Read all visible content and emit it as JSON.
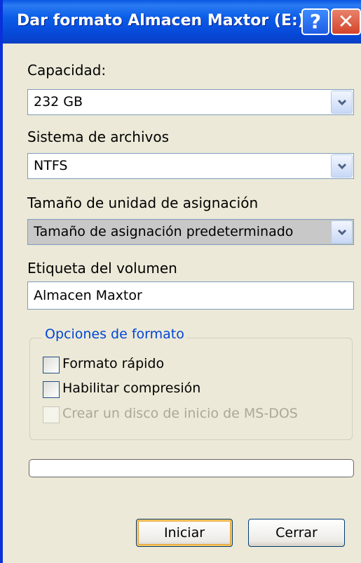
{
  "window": {
    "title": "Dar formato Almacen Maxtor (E:)",
    "help_glyph": "?",
    "close_glyph": "✕"
  },
  "capacity": {
    "label": "Capacidad:",
    "value": "232 GB"
  },
  "filesystem": {
    "label": "Sistema de archivos",
    "value": "NTFS"
  },
  "allocation": {
    "label": "Tamaño de unidad de asignación",
    "value": "Tamaño de asignación predeterminado"
  },
  "volume": {
    "label": "Etiqueta del volumen",
    "value": "Almacen Maxtor"
  },
  "options": {
    "title": "Opciones de formato",
    "items": [
      {
        "label": "Formato rápido",
        "checked": false,
        "enabled": true
      },
      {
        "label": "Habilitar compresión",
        "checked": false,
        "enabled": true
      },
      {
        "label": "Crear un disco de inicio de MS-DOS",
        "checked": false,
        "enabled": false
      }
    ]
  },
  "progress": {
    "fraction": 0
  },
  "buttons": {
    "start": "Iniciar",
    "close": "Cerrar"
  },
  "colors": {
    "titlebar": "#0A57E3",
    "dialog_bg": "#ECE9D8",
    "group_title": "#0046D5",
    "close_button": "#D4442A",
    "default_focus": "#F7C65E"
  },
  "icons": {
    "help": "help-icon",
    "close": "close-icon",
    "dropdown": "chevron-down-icon"
  }
}
